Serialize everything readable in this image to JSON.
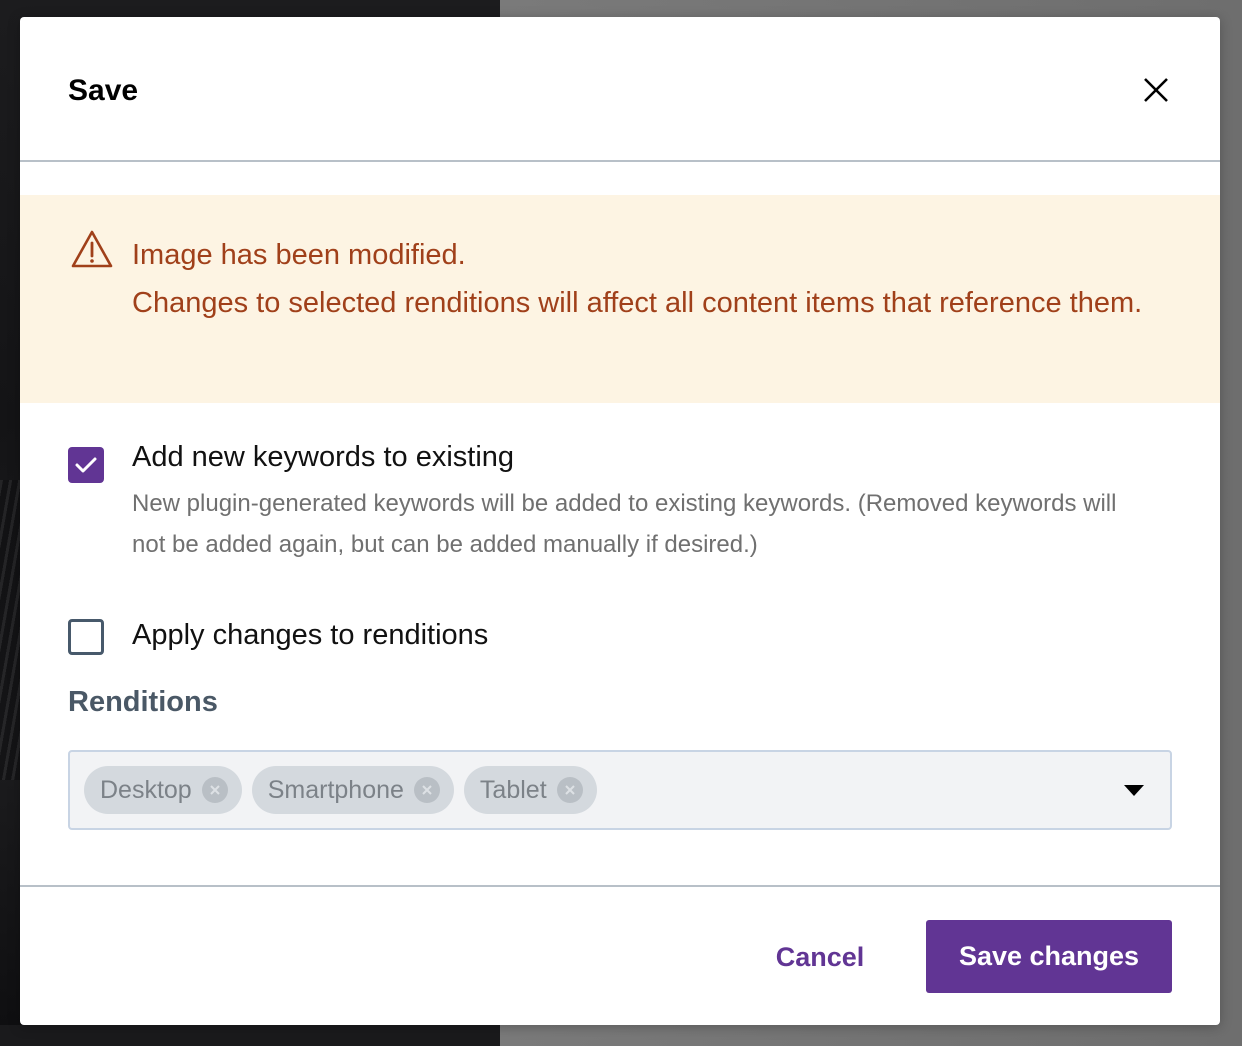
{
  "dialog": {
    "title": "Save",
    "close_icon": "close-icon"
  },
  "warning": {
    "icon": "warning-triangle-icon",
    "line1": "Image has been modified.",
    "line2": "Changes to selected renditions will affect all content items that reference them.",
    "color": "#a0401a",
    "background": "#fdf4e3"
  },
  "options": [
    {
      "label": "Add new keywords to existing",
      "description": "New plugin-generated keywords will be added to existing keywords. (Removed keywords will not be added again, but can be added manually if desired.)",
      "checked": true
    },
    {
      "label": "Apply changes to renditions",
      "checked": false
    }
  ],
  "renditions": {
    "label": "Renditions",
    "selected": [
      "Desktop",
      "Smartphone",
      "Tablet"
    ],
    "disabled": true
  },
  "footer": {
    "cancel_label": "Cancel",
    "save_label": "Save changes"
  },
  "colors": {
    "accent": "#613594"
  }
}
